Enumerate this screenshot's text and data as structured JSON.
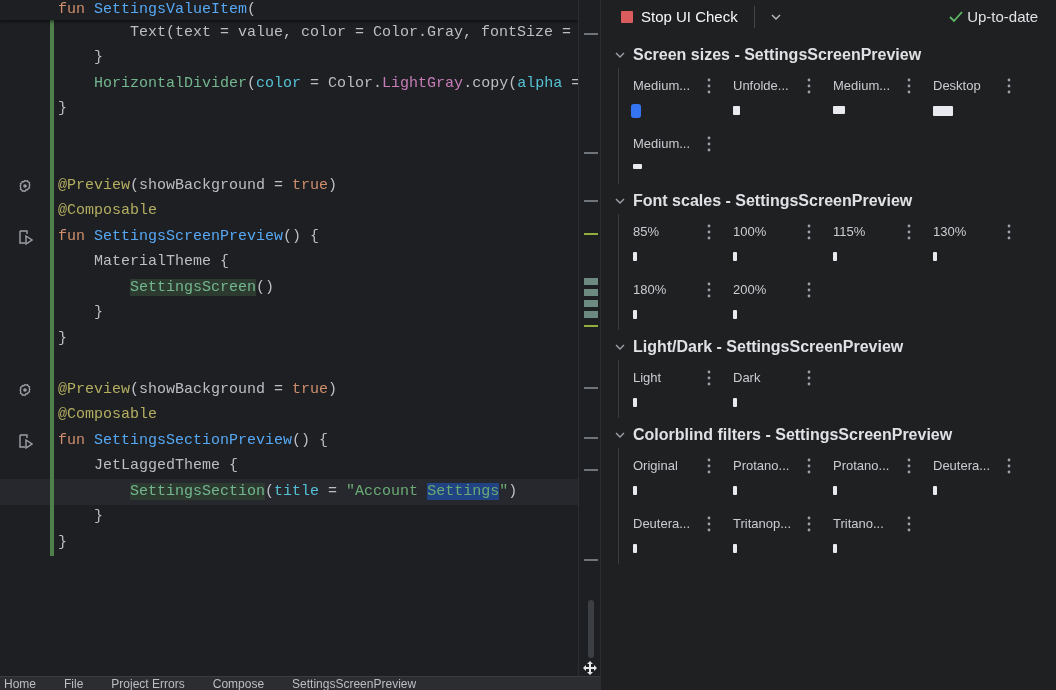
{
  "editor": {
    "lines": [
      {
        "kind": "code",
        "selected": false,
        "segments": [
          {
            "kind": "keyword",
            "text": "fun "
          },
          {
            "kind": "function",
            "text": "SettingsValueItem"
          },
          {
            "kind": "plain",
            "text": "("
          }
        ]
      },
      {
        "kind": "code",
        "selected": false,
        "segments": [
          {
            "kind": "plain",
            "text": "        Text(text = value, color = Color.Gray, fontSize ="
          }
        ]
      },
      {
        "kind": "code",
        "selected": false,
        "segments": [
          {
            "kind": "plain",
            "text": "    }"
          }
        ]
      },
      {
        "kind": "code",
        "selected": false,
        "segments": [
          {
            "kind": "call",
            "text": "    HorizontalDivider"
          },
          {
            "kind": "plain",
            "text": "("
          },
          {
            "kind": "param",
            "text": "color"
          },
          {
            "kind": "plain",
            "text": " = Color."
          },
          {
            "kind": "property",
            "text": "LightGray"
          },
          {
            "kind": "plain",
            "text": ".copy("
          },
          {
            "kind": "param",
            "text": "alpha"
          },
          {
            "kind": "plain",
            "text": " ="
          }
        ]
      },
      {
        "kind": "code",
        "selected": false,
        "segments": [
          {
            "kind": "plain",
            "text": "}"
          }
        ]
      },
      {
        "kind": "blank",
        "selected": false
      },
      {
        "kind": "blank",
        "selected": false
      },
      {
        "kind": "gear",
        "selected": false,
        "segments": [
          {
            "kind": "annotation",
            "text": "@Preview"
          },
          {
            "kind": "plain",
            "text": "(showBackground = "
          },
          {
            "kind": "keyword",
            "text": "true"
          },
          {
            "kind": "plain",
            "text": ")"
          }
        ]
      },
      {
        "kind": "code",
        "selected": false,
        "segments": [
          {
            "kind": "annotation",
            "text": "@Composable"
          }
        ]
      },
      {
        "kind": "preview",
        "selected": false,
        "segments": [
          {
            "kind": "keyword",
            "text": "fun "
          },
          {
            "kind": "function",
            "text": "SettingsScreenPreview"
          },
          {
            "kind": "plain",
            "text": "() {"
          }
        ]
      },
      {
        "kind": "code",
        "selected": false,
        "segments": [
          {
            "kind": "plain",
            "text": "    MaterialTheme {"
          }
        ]
      },
      {
        "kind": "code",
        "selected": false,
        "segments": [
          {
            "kind": "usage",
            "text": "        SettingsScreen"
          },
          {
            "kind": "plain",
            "text": "()"
          }
        ]
      },
      {
        "kind": "code",
        "selected": false,
        "segments": [
          {
            "kind": "plain",
            "text": "    }"
          }
        ]
      },
      {
        "kind": "code",
        "selected": false,
        "segments": [
          {
            "kind": "plain",
            "text": "}"
          }
        ]
      },
      {
        "kind": "blank",
        "selected": false
      },
      {
        "kind": "gear",
        "selected": false,
        "segments": [
          {
            "kind": "annotation",
            "text": "@Preview"
          },
          {
            "kind": "plain",
            "text": "(showBackground = "
          },
          {
            "kind": "keyword",
            "text": "true"
          },
          {
            "kind": "plain",
            "text": ")"
          }
        ]
      },
      {
        "kind": "code",
        "selected": false,
        "segments": [
          {
            "kind": "annotation",
            "text": "@Composable"
          }
        ]
      },
      {
        "kind": "preview",
        "selected": false,
        "segments": [
          {
            "kind": "keyword",
            "text": "fun "
          },
          {
            "kind": "function",
            "text": "SettingsSectionPreview"
          },
          {
            "kind": "plain",
            "text": "() {"
          }
        ]
      },
      {
        "kind": "code",
        "selected": false,
        "segments": [
          {
            "kind": "plain",
            "text": "    JetLaggedTheme {"
          }
        ]
      },
      {
        "kind": "code",
        "selected": true,
        "segments": [
          {
            "kind": "usage",
            "text": "        SettingsSection"
          },
          {
            "kind": "plain",
            "text": "("
          },
          {
            "kind": "param",
            "text": "title"
          },
          {
            "kind": "plain",
            "text": " = "
          },
          {
            "kind": "string",
            "text": "\"Account "
          },
          {
            "kind": "match",
            "text": "Settings"
          },
          {
            "kind": "string",
            "text": "\""
          },
          {
            "kind": "plain",
            "text": ")"
          }
        ]
      },
      {
        "kind": "code",
        "selected": false,
        "segments": [
          {
            "kind": "plain",
            "text": "    }"
          }
        ]
      },
      {
        "kind": "code",
        "selected": false,
        "segments": [
          {
            "kind": "plain",
            "text": "}"
          }
        ]
      }
    ]
  },
  "bottom_tabs": [
    "Home",
    "File",
    "Project Errors",
    "Compose",
    "SettingsScreenPreview"
  ],
  "toolbar": {
    "stop_label": "Stop UI Check",
    "status": "Up-to-date"
  },
  "sections": [
    {
      "title": "Screen sizes - SettingsScreenPreview",
      "expanded": true,
      "items": [
        {
          "label": "Medium...",
          "kind": "portrait",
          "selected": true
        },
        {
          "label": "Unfolde...",
          "kind": "square",
          "selected": false
        },
        {
          "label": "Medium...",
          "kind": "landscape",
          "selected": false
        },
        {
          "label": "Desktop",
          "kind": "wide",
          "selected": false
        },
        {
          "label": "Medium...",
          "kind": "flat",
          "selected": false
        }
      ]
    },
    {
      "title": "Font scales - SettingsScreenPreview",
      "expanded": true,
      "items": [
        {
          "label": "85%",
          "kind": "slim",
          "selected": false
        },
        {
          "label": "100%",
          "kind": "slim",
          "selected": false
        },
        {
          "label": "115%",
          "kind": "slim",
          "selected": false
        },
        {
          "label": "130%",
          "kind": "slim",
          "selected": false
        },
        {
          "label": "180%",
          "kind": "slim",
          "selected": false
        },
        {
          "label": "200%",
          "kind": "slim",
          "selected": false
        }
      ]
    },
    {
      "title": "Light/Dark - SettingsScreenPreview",
      "expanded": true,
      "items": [
        {
          "label": "Light",
          "kind": "slim",
          "selected": false
        },
        {
          "label": "Dark",
          "kind": "slim",
          "selected": false
        }
      ]
    },
    {
      "title": "Colorblind filters - SettingsScreenPreview",
      "expanded": true,
      "items": [
        {
          "label": "Original",
          "kind": "slim",
          "selected": false
        },
        {
          "label": "Protano...",
          "kind": "slim",
          "selected": false
        },
        {
          "label": "Protano...",
          "kind": "slim",
          "selected": false
        },
        {
          "label": "Deutera...",
          "kind": "slim",
          "selected": false
        },
        {
          "label": "Deutera...",
          "kind": "slim",
          "selected": false
        },
        {
          "label": "Tritanop...",
          "kind": "slim",
          "selected": false
        },
        {
          "label": "Tritano...",
          "kind": "slim",
          "selected": false
        }
      ]
    }
  ]
}
